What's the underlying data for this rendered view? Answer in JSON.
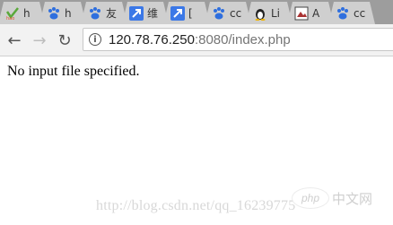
{
  "tabs": [
    {
      "label": "h",
      "icon": "hao123-icon"
    },
    {
      "label": "h",
      "icon": "baidu-paw-icon"
    },
    {
      "label": "友",
      "icon": "baidu-paw-icon"
    },
    {
      "label": "维",
      "icon": "arrow-app-icon"
    },
    {
      "label": "[",
      "icon": "arrow-app-icon"
    },
    {
      "label": "cc",
      "icon": "baidu-paw-icon"
    },
    {
      "label": "Li",
      "icon": "linux-penguin-icon"
    },
    {
      "label": "A",
      "icon": "image-icon"
    },
    {
      "label": "cc",
      "icon": "baidu-paw-icon"
    }
  ],
  "toolbar": {
    "back": "←",
    "forward": "→",
    "reload": "↻",
    "url_host": "120.78.76.250",
    "url_rest": ":8080/index.php"
  },
  "page": {
    "message": "No input file specified."
  },
  "watermark": {
    "url_text": "http://blog.csdn.net/qq_16239775",
    "badge_text": "php",
    "site_text": "中文网"
  }
}
